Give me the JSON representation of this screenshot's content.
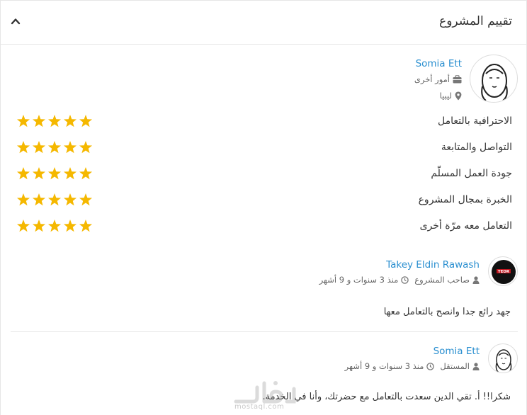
{
  "header": {
    "title": "تقييم المشروع"
  },
  "freelancer": {
    "name": "Somia Ett",
    "category": "أمور أخرى",
    "location": "ليبيا"
  },
  "ratings": [
    {
      "label": "الاحترافية بالتعامل",
      "stars": 5
    },
    {
      "label": "التواصل والمتابعة",
      "stars": 5
    },
    {
      "label": "جودة العمل المسلّم",
      "stars": 5
    },
    {
      "label": "الخبرة بمجال المشروع",
      "stars": 5
    },
    {
      "label": "التعامل معه مرّة أخرى",
      "stars": 5
    }
  ],
  "reviews": [
    {
      "name": "Takey Eldin Rawash",
      "role": "صاحب المشروع",
      "time": "منذ 3 سنوات و 9 أشهر",
      "text": "جهد رائع جدا وانصح بالتعامل معها"
    },
    {
      "name": "Somia Ett",
      "role": "المستقل",
      "time": "منذ 3 سنوات و 9 أشهر",
      "text": "شكرا!! أ. تقي الدين سعدت بالتعامل مع حضرتك، وأنا في الخدمة."
    }
  ],
  "colors": {
    "star": "#f5b800",
    "link": "#2a8fd0"
  },
  "watermark": {
    "text": "mostaql.com"
  }
}
